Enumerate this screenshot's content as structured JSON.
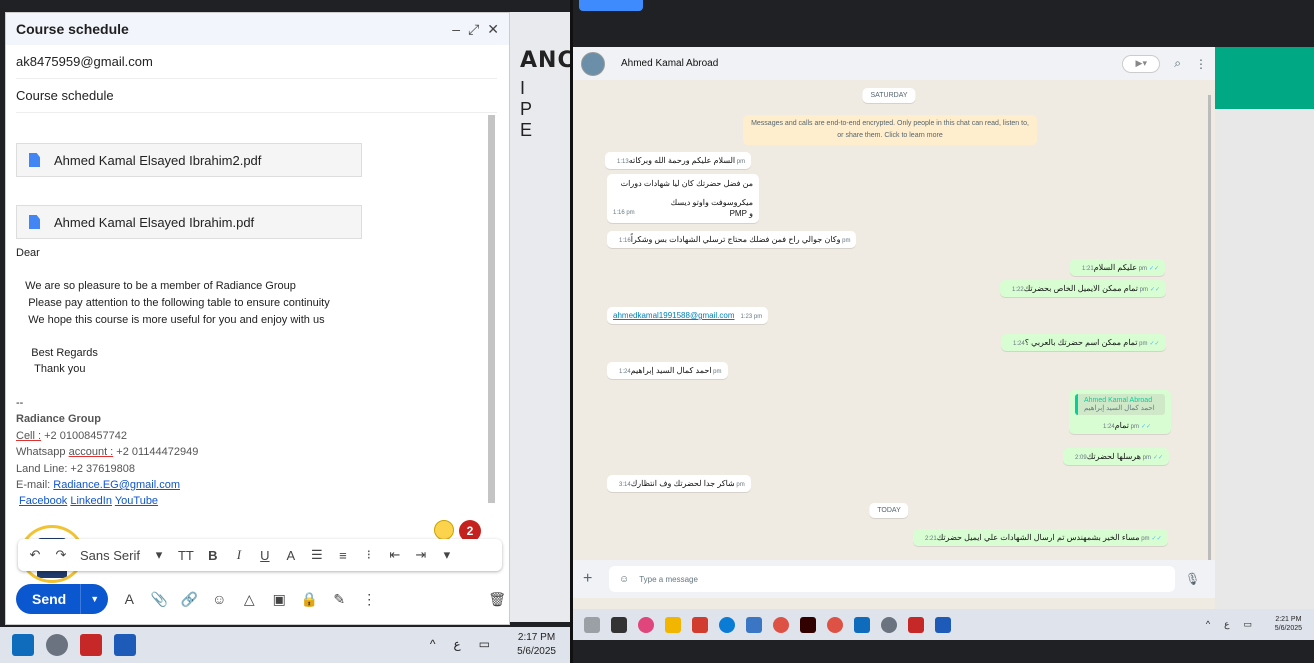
{
  "gmail": {
    "title": "Course schedule",
    "to": "ak8475959@gmail.com",
    "subject": "Course schedule",
    "attachments": [
      "Ahmed Kamal Elsayed Ibrahim2.pdf",
      "Ahmed Kamal Elsayed Ibrahim.pdf"
    ],
    "body_lines": [
      "Dear",
      "   We are so pleasure to be a member of Radiance Group",
      "    Please pay attention to the following table to ensure continuity",
      "    We hope this course is more useful for you and enjoy with us",
      "     Best Regards",
      "      Thank you",
      "--"
    ],
    "signature": {
      "company": "Radiance Group",
      "cell_label": "Cell :",
      "cell_value": " +2 01008457742",
      "whatsapp_prefix": "Whatsapp ",
      "whatsapp_label": "account :",
      "whatsapp_value": " +2 01144472949",
      "landline": "Land Line: +2 37619808",
      "email_label": "E-mail: ",
      "email_value": "Radiance.EG@gmail.com",
      "links": [
        "Facebook",
        "LinkedIn",
        "YouTube"
      ]
    },
    "badge_count": "2",
    "format_font": "Sans Serif",
    "send_label": "Send"
  },
  "left_taskbar": {
    "time": "2:17 PM",
    "date": "5/6/2025",
    "lang": "ع"
  },
  "background_text": {
    "brand1": "ANCE",
    "brand2": "I P E"
  },
  "whatsapp": {
    "contact": "Ahmed Kamal Abroad",
    "day_chips": [
      "SATURDAY",
      "TODAY"
    ],
    "encryption_notice": "Messages and calls are end-to-end encrypted. Only people in this chat can read, listen to, or share them. Click to learn more",
    "messages": [
      {
        "dir": "in",
        "text": "السلام عليكم ورحمة الله وبركاته",
        "time": "1:13 pm"
      },
      {
        "dir": "in",
        "text": "من فضل حضرتك كان ليا شهادات دورات",
        "text2": "ميكروسوفت واوتو ديسك",
        "text3": "و PMP",
        "time": "1:16 pm"
      },
      {
        "dir": "in",
        "text": "وكان جوالي راح فمن فضلك محتاج ترسلي الشهادات بس وشكراً",
        "time": "1:16 pm"
      },
      {
        "dir": "out",
        "text": "عليكم السلام",
        "time": "1:21 pm"
      },
      {
        "dir": "out",
        "text": "تمام ممكن الايميل الخاص بحضرتك",
        "time": "1:22 pm"
      },
      {
        "dir": "in",
        "text": "ahmedkamal1991588@gmail.com",
        "time": "1:23 pm"
      },
      {
        "dir": "out",
        "text": "تمام ممكن اسم حضرتك بالعربي ؟",
        "time": "1:24 pm"
      },
      {
        "dir": "in",
        "text": "احمد كمال السيد إبراهيم",
        "time": "1:24 pm"
      },
      {
        "dir": "out",
        "quote_name": "Ahmed Kamal Abroad",
        "quote_text": "احمد كمال السيد إبراهيم",
        "text": "تمام",
        "time": "1:24 pm"
      },
      {
        "dir": "out",
        "text": "هرسلها لحضرتك",
        "time": "2:09 pm"
      },
      {
        "dir": "in",
        "text": "شاكر جدا لحضرتك وف انتظارك",
        "time": "3:14 pm"
      },
      {
        "dir": "out",
        "text": "مساء الخير بشمهندس تم ارسال الشهادات علي ايميل حضرتك",
        "time": "2:21 pm"
      }
    ],
    "input_placeholder": "Type a message"
  },
  "right_taskbar": {
    "time": "2:21 PM",
    "date": "5/6/2025",
    "lang": "ع"
  },
  "colors": {
    "gmail_send": "#0b57d0",
    "wa_out_bubble": "#d9fdd3",
    "wa_green": "#00a884"
  }
}
